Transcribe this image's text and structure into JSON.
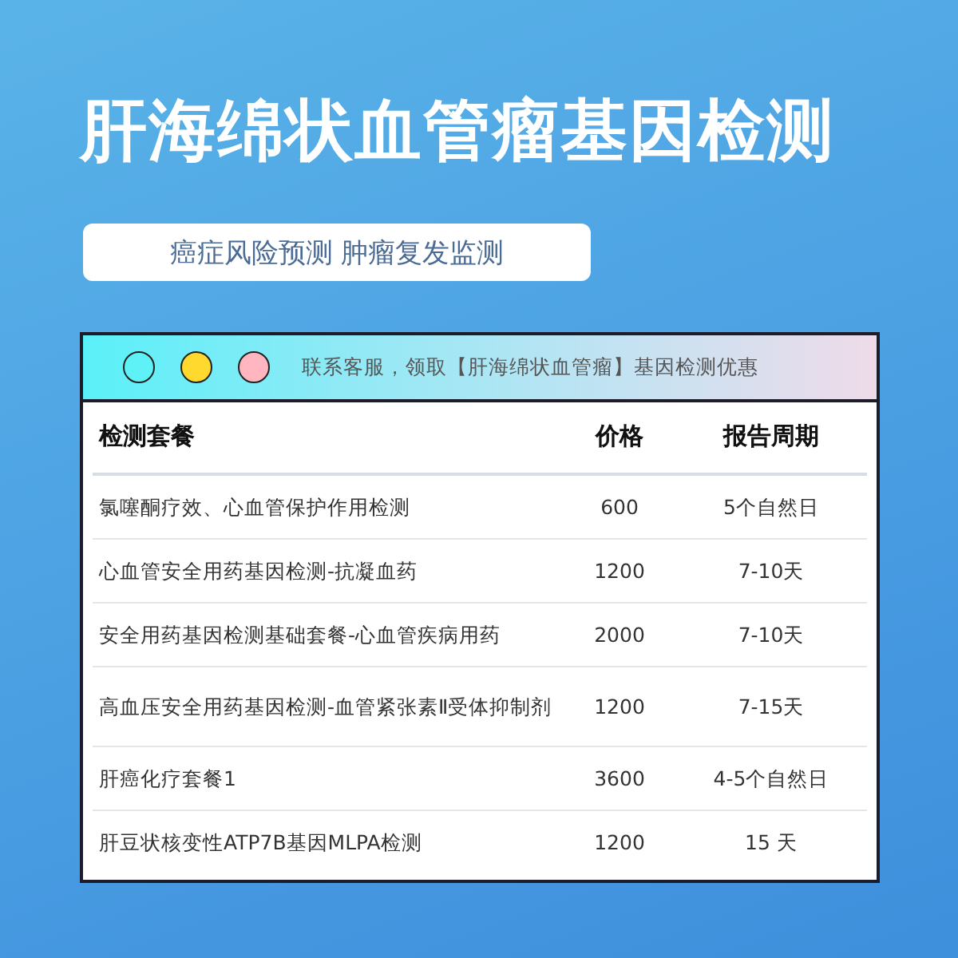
{
  "title": "肝海绵状血管瘤基因检测",
  "subtitle": "癌症风险预测 肿瘤复发监测",
  "window": {
    "dots": [
      {
        "color": "#5ef2f7"
      },
      {
        "color": "#ffd92e"
      },
      {
        "color": "#ffb6c1"
      }
    ],
    "notice": "联系客服，领取【肝海绵状血管瘤】基因检测优惠"
  },
  "table": {
    "columns": [
      "检测套餐",
      "价格",
      "报告周期"
    ],
    "rows": [
      [
        "氯噻酮疗效、心血管保护作用检测",
        "600",
        "5个自然日"
      ],
      [
        "心血管安全用药基因检测-抗凝血药",
        "1200",
        "7-10天"
      ],
      [
        "安全用药基因检测基础套餐-心血管疾病用药",
        "2000",
        "7-10天"
      ],
      [
        "高血压安全用药基因检测-血管紧张素Ⅱ受体抑制剂",
        "1200",
        "7-15天"
      ],
      [
        "肝癌化疗套餐1",
        "3600",
        "4-5个自然日"
      ],
      [
        "肝豆状核变性ATP7B基因MLPA检测",
        "1200",
        "15 天"
      ]
    ]
  }
}
